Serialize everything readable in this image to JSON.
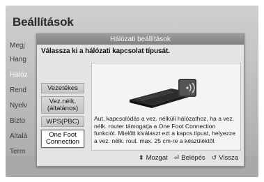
{
  "screen": {
    "title": "Beállítások",
    "background_menu": [
      "Megj",
      "Hang",
      "Hálóz",
      "Rend",
      "Nyelv",
      "Bizto",
      "Általá",
      "Term"
    ]
  },
  "dialog": {
    "header": "Hálózati beállítások",
    "prompt": "Válassza ki a hálózati kapcsolat típusát.",
    "options": [
      {
        "label": "Vezetékes"
      },
      {
        "label": "Vez.nélk. (általános)"
      },
      {
        "label": "WPS(PBC)"
      },
      {
        "label": "One Foot Connection",
        "selected": true
      }
    ],
    "description": "Aut. kapcsolódás a vez. nélküli hálózathoz, ha a vez. nélk. router támogatja a One Foot Connection funkciót. Mielőtt kiválaszt ezt a kapcs.típust, helyezze a vez. nélk. rout. max. 25 cm-re a készüléktől.",
    "footer": [
      {
        "icon": "updown-arrows-icon",
        "symbol": "⬍",
        "label": "Mozgat"
      },
      {
        "icon": "enter-icon",
        "symbol": "⏎",
        "label": "Belépés"
      },
      {
        "icon": "return-icon",
        "symbol": "↺",
        "label": "Vissza"
      }
    ]
  }
}
